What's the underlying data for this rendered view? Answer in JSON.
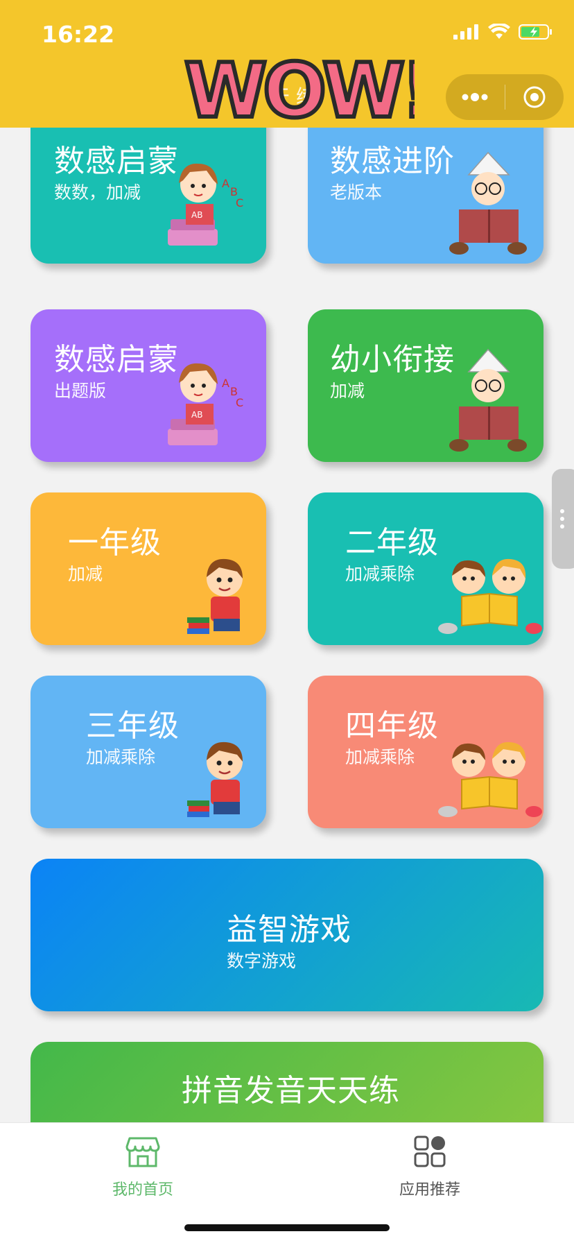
{
  "status_bar": {
    "time": "16:22"
  },
  "header": {
    "banner_text": "WOW!",
    "subtitle_fragment": "天  练"
  },
  "cards": [
    {
      "title": "数感启蒙",
      "sub": "数数，加减",
      "bg": "#19bfb2"
    },
    {
      "title": "数感进阶",
      "sub": "老版本",
      "bg": "#62b5f4"
    },
    {
      "title": "数感启蒙",
      "sub": "出题版",
      "bg": "#a56ffa"
    },
    {
      "title": "幼小衔接",
      "sub": "加减",
      "bg": "#3dba4e"
    },
    {
      "title": "一年级",
      "sub": "加减",
      "bg": "#fdb83a"
    },
    {
      "title": "二年级",
      "sub": "加减乘除",
      "bg": "#19bfb2"
    },
    {
      "title": "三年级",
      "sub": "加减乘除",
      "bg": "#62b5f4"
    },
    {
      "title": "四年级",
      "sub": "加减乘除",
      "bg": "#f88a76"
    },
    {
      "title": "益智游戏",
      "sub": "数字游戏",
      "bg": "linear-gradient(135deg,#0b83f6,#18b9b3)"
    },
    {
      "title": "拼音发音天天练",
      "sub": "",
      "bg": "linear-gradient(135deg,#43b84a,#8dc83f)"
    }
  ],
  "tabbar": {
    "items": [
      {
        "label": "我的首页",
        "color": "#5db86a",
        "active": true
      },
      {
        "label": "应用推荐",
        "color": "#555555",
        "active": false
      }
    ]
  },
  "colors": {
    "header": "#f4c62b",
    "accent_green": "#5db86a"
  }
}
